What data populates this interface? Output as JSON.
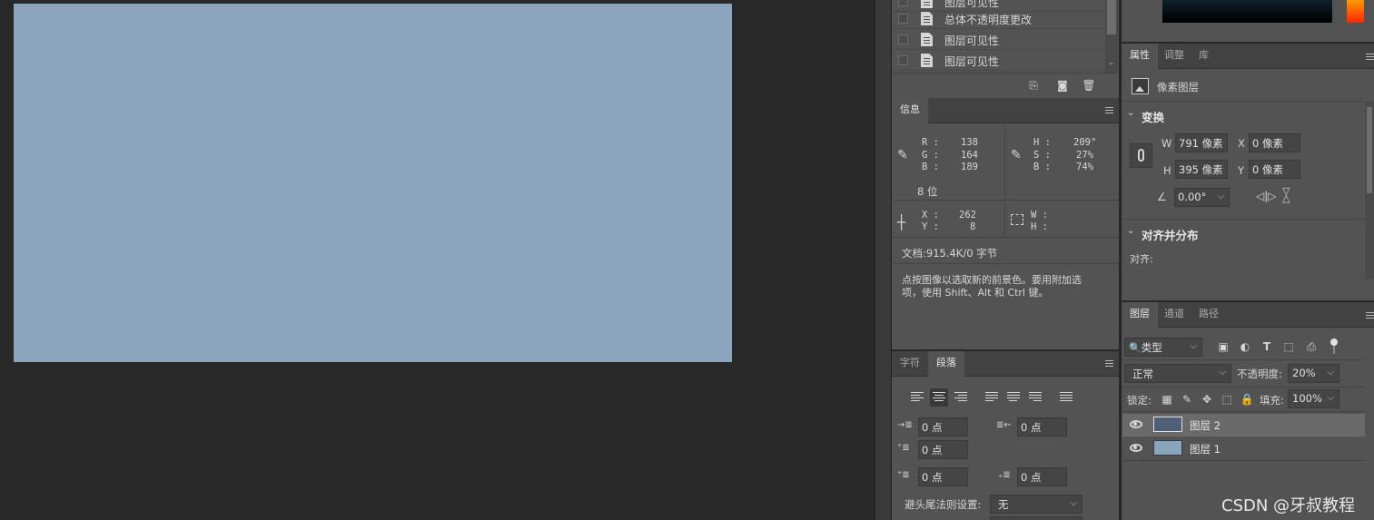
{
  "history": {
    "items": [
      {
        "label": "图层可见性"
      },
      {
        "label": "总体不透明度更改"
      },
      {
        "label": "图层可见性"
      },
      {
        "label": "图层可见性"
      }
    ]
  },
  "info_panel": {
    "tab": "信息",
    "rgb": {
      "r_label": "R :",
      "g_label": "G :",
      "b_label": "B :",
      "r": "138",
      "g": "164",
      "b": "189"
    },
    "hsb": {
      "h_label": "H :",
      "s_label": "S :",
      "b_label": "B :",
      "h": "209°",
      "s": "27%",
      "b": "74%"
    },
    "bit_depth": "8 位",
    "xy": {
      "x_label": "X :",
      "y_label": "Y :",
      "x": "262",
      "y": "8"
    },
    "wh": {
      "w_label": "W :",
      "h_label": "H :"
    },
    "doc": "文档:915.4K/0 字节",
    "hint_line1": "点按图像以选取新的前景色。要用附加选",
    "hint_line2": "项，使用 Shift、Alt 和 Ctrl 键。"
  },
  "char_panel": {
    "tabs": [
      "字符",
      "段落"
    ],
    "indent_left": "0 点",
    "indent_right": "0 点",
    "indent_first": "0 点",
    "space_before": "0 点",
    "space_after": "0 点",
    "kinsoku_label": "避头尾法则设置:",
    "kinsoku_value": "无"
  },
  "properties_panel": {
    "tabs": [
      "属性",
      "调整",
      "库"
    ],
    "layer_type": "像素图层",
    "transform_title": "变换",
    "w_label": "W",
    "h_label": "H",
    "x_label": "X",
    "y_label": "Y",
    "w": "791 像素",
    "h": "395 像素",
    "x": "0 像素",
    "y": "0 像素",
    "angle": "0.00°",
    "align_title": "对齐并分布",
    "align_label": "对齐:"
  },
  "layers_panel": {
    "tabs": [
      "图层",
      "通道",
      "路径"
    ],
    "filter": "类型",
    "blend_mode": "正常",
    "opacity_label": "不透明度:",
    "opacity": "20%",
    "lock_label": "锁定:",
    "fill_label": "填充:",
    "fill": "100%",
    "layers": [
      {
        "name": "图层 2",
        "thumb_color": "#4f5f77",
        "selected": true
      },
      {
        "name": "图层 1",
        "thumb_color": "#8aa4bd",
        "selected": false
      }
    ]
  },
  "canvas": {
    "fill_color": "#8aa4bd"
  },
  "watermark": "CSDN @牙叔教程"
}
